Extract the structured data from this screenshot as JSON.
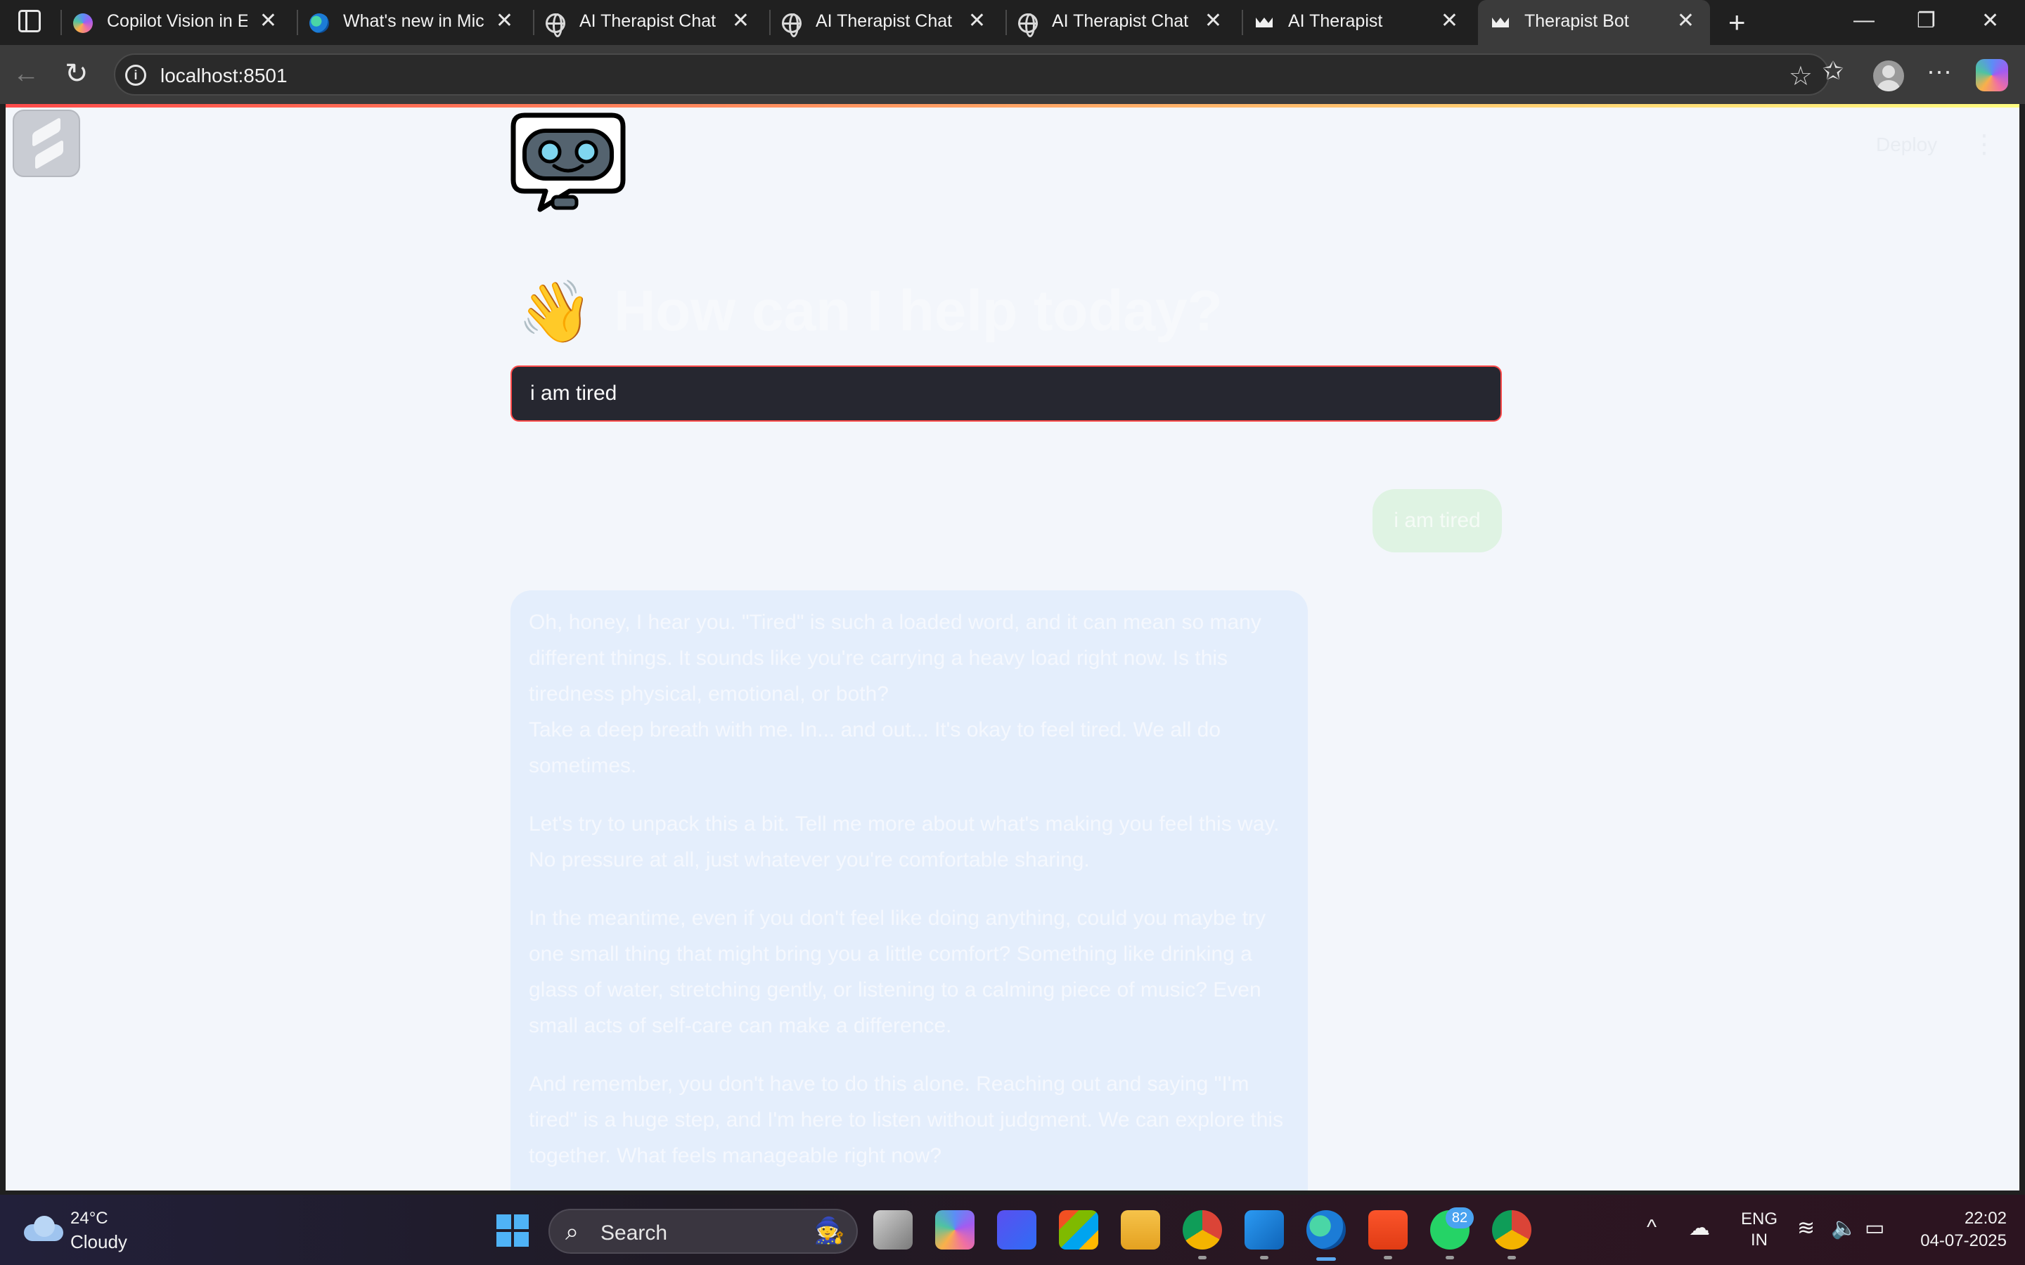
{
  "browser": {
    "tabs": [
      {
        "title": "Copilot Vision in Edge",
        "icon": "copilot-icon"
      },
      {
        "title": "What's new in Microsoft Edge",
        "icon": "edge-icon"
      },
      {
        "title": "AI Therapist Chat",
        "icon": "globe-icon"
      },
      {
        "title": "AI Therapist Chat",
        "icon": "globe-icon"
      },
      {
        "title": "AI Therapist Chat",
        "icon": "globe-icon"
      },
      {
        "title": "AI Therapist",
        "icon": "streamlit-crown-icon"
      },
      {
        "title": "Therapist Bot",
        "icon": "streamlit-crown-icon",
        "active": true
      }
    ],
    "url": "localhost:8501"
  },
  "app": {
    "deploy_label": "Deploy",
    "title": "How can I help today?",
    "title_emoji": "👋",
    "input_value": "i am tired",
    "accent_color": "#ff4b4b"
  },
  "chat": {
    "user_message": "i am tired",
    "bot_paragraphs": [
      "Oh, honey, I hear you. \"Tired\" is such a loaded word, and it can mean so many different things. It sounds like you're carrying a heavy load right now. Is this tiredness physical, emotional, or both?",
      "Take a deep breath with me. In... and out... It's okay to feel tired. We all do sometimes.",
      "Let's try to unpack this a bit. Tell me more about what's making you feel this way. No pressure at all, just whatever you're comfortable sharing.",
      "In the meantime, even if you don't feel like doing anything, could you maybe try one small thing that might bring you a little comfort? Something like drinking a glass of water, stretching gently, or listening to a calming piece of music? Even small acts of self-care can make a difference.",
      "And remember, you don't have to do this alone. Reaching out and saying \"I'm tired\" is a huge step, and I'm here to listen without judgment. We can explore this together. What feels manageable right now?"
    ]
  },
  "taskbar": {
    "weather_temp": "24°C",
    "weather_desc": "Cloudy",
    "search_label": "Search",
    "whatsapp_badge": "82",
    "lang_line1": "ENG",
    "lang_line2": "IN",
    "time": "22:02",
    "date": "04-07-2025"
  }
}
